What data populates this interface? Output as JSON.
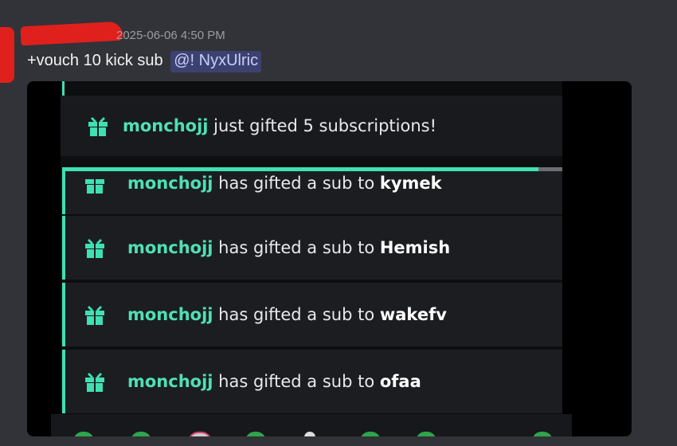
{
  "message": {
    "timestamp": "2025-06-06 4:50 PM",
    "text": "+vouch 10 kick sub",
    "mention": "@! NyxUlric"
  },
  "embed": {
    "header": {
      "user": "monchojj",
      "text": " just gifted 5 subscriptions!"
    },
    "rows": [
      {
        "user": "monchojj",
        "text": " has gifted a sub to ",
        "recipient": "kymek"
      },
      {
        "user": "monchojj",
        "text": " has gifted a sub to ",
        "recipient": "Hemish"
      },
      {
        "user": "monchojj",
        "text": " has gifted a sub to ",
        "recipient": "wakefv"
      },
      {
        "user": "monchojj",
        "text": " has gifted a sub to ",
        "recipient": "ofaa"
      }
    ]
  },
  "colors": {
    "accent": "#3fe0b3",
    "username": "#4fe0b5",
    "redaction": "#e0201c",
    "mention_bg": "#3c4270"
  },
  "icons": [
    "gift-icon"
  ]
}
